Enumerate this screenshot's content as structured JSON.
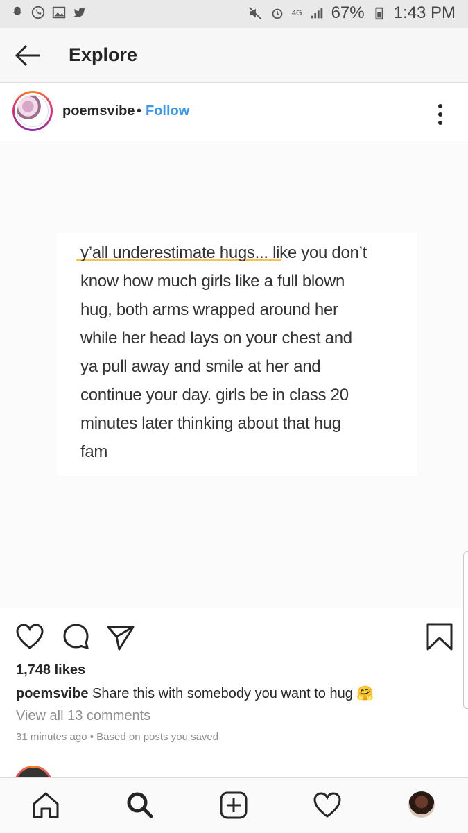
{
  "status_bar": {
    "battery": "67%",
    "time": "1:43 PM",
    "network": "4G",
    "left_icons": [
      "snapchat-icon",
      "whatsapp-icon",
      "gallery-icon",
      "twitter-icon"
    ],
    "right_icons": [
      "mute-icon",
      "alarm-icon",
      "network-4g-icon",
      "signal-icon",
      "battery-icon"
    ]
  },
  "header": {
    "title": "Explore",
    "back_icon": "arrow-left-icon"
  },
  "post": {
    "username": "poemsvibe",
    "separator": "•",
    "follow_label": "Follow",
    "more_icon": "more-vertical-icon",
    "image_text": "y’all underestimate hugs... like you don’t\nknow how much girls like a full blown\nhug, both arms wrapped around her\nwhile her head lays on your chest and\nya pull away and smile at her and\ncontinue your day. girls be in class 20\nminutes later thinking about that hug\nfam",
    "highlight_color": "#f6c451",
    "likes": "1,748 likes",
    "caption_user": "poemsvibe",
    "caption_text": " Share this with somebody you want to hug 🤗",
    "view_comments": "View all 13 comments",
    "meta": "31 minutes ago • Based on posts you saved"
  },
  "actions": [
    "heart-icon",
    "comment-icon",
    "share-icon",
    "bookmark-icon"
  ],
  "bottom_nav": [
    "home-icon",
    "search-icon",
    "add-post-icon",
    "activity-heart-icon",
    "profile-avatar"
  ],
  "colors": {
    "link_blue": "#3897f0",
    "text": "#262626",
    "secondary_text": "#8e8e8e"
  }
}
